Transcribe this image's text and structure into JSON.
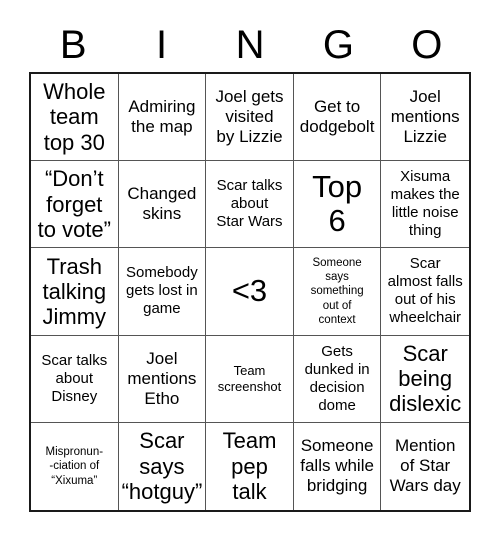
{
  "card": {
    "title": "BINGO",
    "header_letters": [
      "B",
      "I",
      "N",
      "G",
      "O"
    ],
    "columns": 5,
    "rows": 5,
    "colors": {
      "background": "#ffffff",
      "cell_background": "#ffffff",
      "text": "#000000",
      "outer_border": "#1a1a1a",
      "inner_border": "#555555"
    },
    "cells": [
      {
        "text": "Whole\nteam\ntop 30",
        "size": "lg"
      },
      {
        "text": "Admiring\nthe map",
        "size": "md"
      },
      {
        "text": "Joel gets\nvisited\nby Lizzie",
        "size": "md"
      },
      {
        "text": "Get to\ndodgebolt",
        "size": "md"
      },
      {
        "text": "Joel\nmentions\nLizzie",
        "size": "md"
      },
      {
        "text": "“Don’t\nforget\nto vote”",
        "size": "lg"
      },
      {
        "text": "Changed\nskins",
        "size": "md"
      },
      {
        "text": "Scar talks\nabout\nStar Wars",
        "size": "sm"
      },
      {
        "text": "Top\n6",
        "size": "xl"
      },
      {
        "text": "Xisuma\nmakes the\nlittle noise\nthing",
        "size": "sm"
      },
      {
        "text": "Trash\ntalking\nJimmy",
        "size": "lg"
      },
      {
        "text": "Somebody\ngets lost in\ngame",
        "size": "sm"
      },
      {
        "text": "<3",
        "size": "xl"
      },
      {
        "text": "Someone\nsays\nsomething\nout of\ncontext",
        "size": "xxs"
      },
      {
        "text": "Scar\nalmost falls\nout of his\nwheelchair",
        "size": "sm"
      },
      {
        "text": "Scar talks\nabout\nDisney",
        "size": "sm"
      },
      {
        "text": "Joel\nmentions\nEtho",
        "size": "md"
      },
      {
        "text": "Team\nscreenshot",
        "size": "xs"
      },
      {
        "text": "Gets\ndunked in\ndecision\ndome",
        "size": "sm"
      },
      {
        "text": "Scar\nbeing\ndislexic",
        "size": "lg"
      },
      {
        "text": "Mispronun-\n-ciation of\n“Xixuma”",
        "size": "xxs"
      },
      {
        "text": "Scar\nsays\n“hotguy”",
        "size": "lg"
      },
      {
        "text": "Team\npep\ntalk",
        "size": "lg"
      },
      {
        "text": "Someone\nfalls while\nbridging",
        "size": "md"
      },
      {
        "text": "Mention\nof Star\nWars day",
        "size": "md"
      }
    ]
  }
}
